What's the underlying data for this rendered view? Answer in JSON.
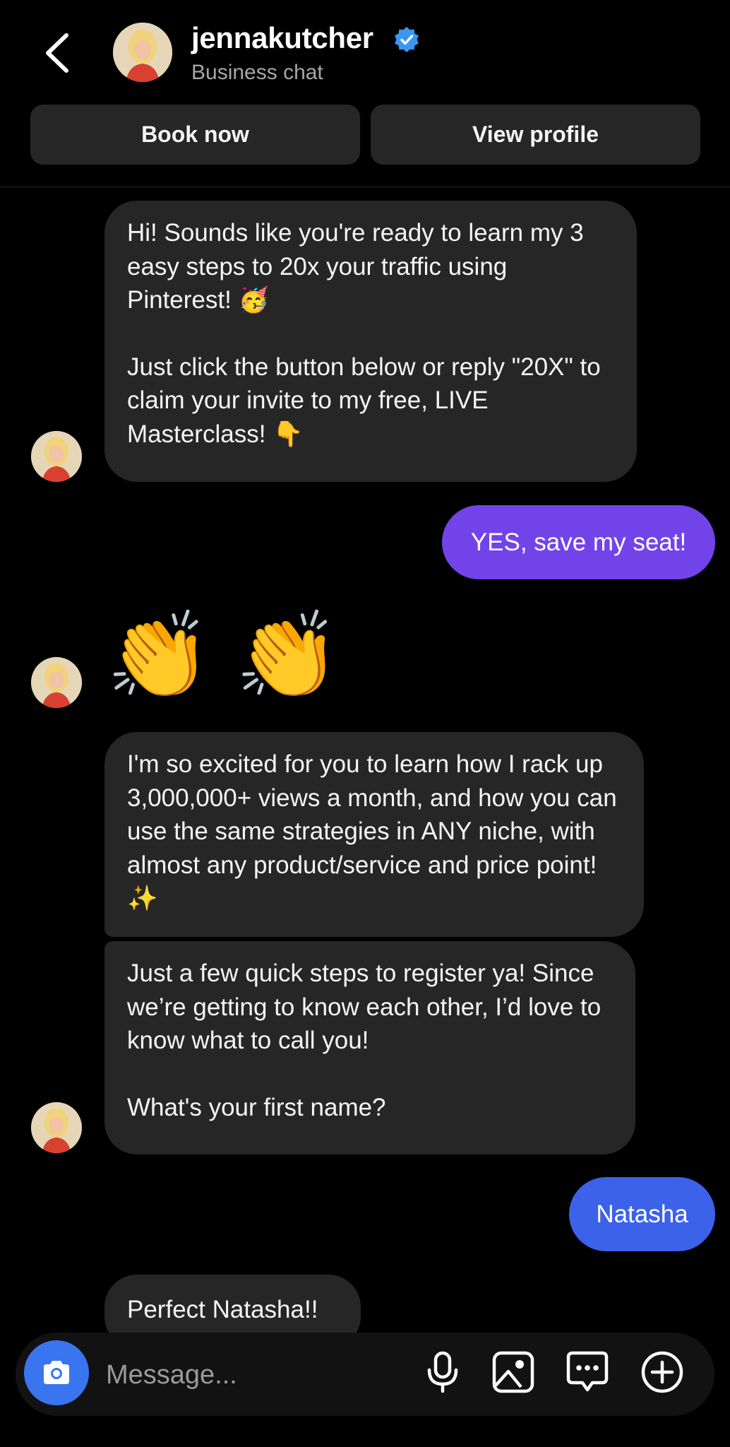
{
  "header": {
    "username": "jennakutcher",
    "subtitle": "Business chat",
    "book_label": "Book now",
    "profile_label": "View profile"
  },
  "messages": {
    "m1_p1": "Hi! Sounds like you're ready to learn my 3 easy steps to 20x your traffic using Pinterest! 🥳",
    "m1_p2": "Just click the button below or reply \"20X\" to claim your invite to my free, LIVE Masterclass!  👇",
    "m2": "YES, save my seat!",
    "m3": "👏 👏",
    "m4": "I'm so excited for you to learn how I rack up 3,000,000+ views a month, and how you can use the same strategies in ANY niche, with almost any product/service and price point! ✨",
    "m5_p1": "Just a few quick steps to register ya! Since we’re getting to know each other, I’d love to know what to call you!",
    "m5_p2": "What's your first name?",
    "m6": "Natasha",
    "m7": "Perfect Natasha!!"
  },
  "composer": {
    "placeholder": "Message..."
  },
  "icons": {
    "back": "back-arrow-icon",
    "verified": "verified-badge-icon",
    "camera": "camera-icon",
    "mic": "microphone-icon",
    "gallery": "image-icon",
    "chat": "chat-bubble-icon",
    "add": "plus-circle-icon"
  },
  "colors": {
    "background": "#000000",
    "incoming_bubble": "#262626",
    "outgoing_purple": "#7343ea",
    "outgoing_blue": "#3b62e8",
    "camera_blue": "#3a75f0",
    "verified_blue": "#3897f0"
  }
}
